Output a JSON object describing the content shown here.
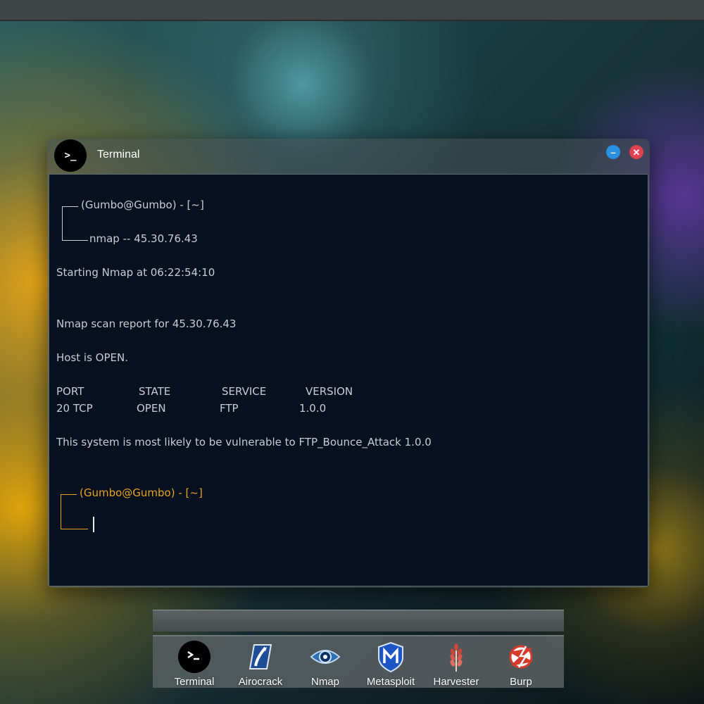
{
  "window": {
    "title": "Terminal",
    "icon": "terminal-icon",
    "icon_glyph": ">_",
    "minimize_glyph": "–",
    "close_glyph": "✕"
  },
  "terminal": {
    "prompt_line": "(Gumbo@Gumbo) - [~]",
    "command_line": "nmap -- 45.30.76.43",
    "start_line": "Starting Nmap at 06:22:54:10",
    "report_line": "Nmap scan report for 45.30.76.43",
    "host_line": "Host is OPEN.",
    "table_headers": [
      "PORT",
      "STATE",
      "SERVICE",
      "VERSION"
    ],
    "table_row": [
      "20 TCP",
      "OPEN",
      "FTP",
      "1.0.0"
    ],
    "vuln_line": "This system is most likely to be vulnerable to FTP_Bounce_Attack 1.0.0",
    "prompt_line_2": "(Gumbo@Gumbo) - [~]"
  },
  "dock": {
    "items": [
      {
        "label": "Terminal",
        "icon": "terminal-icon"
      },
      {
        "label": "Airocrack",
        "icon": "airocrack-icon"
      },
      {
        "label": "Nmap",
        "icon": "eye-icon"
      },
      {
        "label": "Metasploit",
        "icon": "metasploit-shield-icon"
      },
      {
        "label": "Harvester",
        "icon": "wheat-icon"
      },
      {
        "label": "Burp",
        "icon": "burp-icon"
      }
    ]
  },
  "colors": {
    "terminal_bg": "#06101f",
    "text": "#c8ccd2",
    "prompt_accent": "#e7a321",
    "minimize_button": "#2b8fe0",
    "close_button": "#e0414f"
  }
}
